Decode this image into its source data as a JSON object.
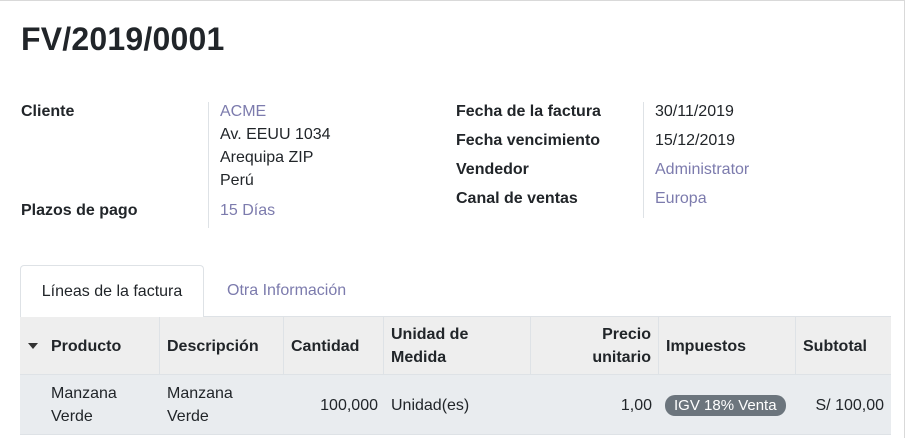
{
  "title": "FV/2019/0001",
  "left_fields": {
    "client_label": "Cliente",
    "client_name": "ACME",
    "address_line1": "Av. EEUU 1034",
    "address_line2": "Arequipa ZIP",
    "address_line3": "Perú",
    "payment_terms_label": "Plazos de pago",
    "payment_terms_value": "15 Días"
  },
  "right_fields": {
    "invoice_date_label": "Fecha de la factura",
    "invoice_date_value": "30/11/2019",
    "due_date_label": "Fecha vencimiento",
    "due_date_value": "15/12/2019",
    "salesperson_label": "Vendedor",
    "salesperson_value": "Administrator",
    "channel_label": "Canal de ventas",
    "channel_value": "Europa"
  },
  "tabs": [
    {
      "label": "Líneas de la factura",
      "active": true
    },
    {
      "label": "Otra Información",
      "active": false
    }
  ],
  "table": {
    "headers": {
      "product": "Producto",
      "description": "Descripción",
      "quantity": "Cantidad",
      "uom_line1": "Unidad de",
      "uom_line2": "Medida",
      "price_line1": "Precio",
      "price_line2": "unitario",
      "taxes": "Impuestos",
      "subtotal": "Subtotal"
    },
    "rows": [
      {
        "product_line1": "Manzana",
        "product_line2": "Verde",
        "description_line1": "Manzana",
        "description_line2": "Verde",
        "quantity": "100,000",
        "uom": "Unidad(es)",
        "price": "1,00",
        "tax": "IGV 18% Venta",
        "subtotal": "S/ 100,00"
      }
    ]
  },
  "colors": {
    "link": "#7c7bad",
    "badge": "#6c757d",
    "header_bg": "#eeeeee"
  }
}
